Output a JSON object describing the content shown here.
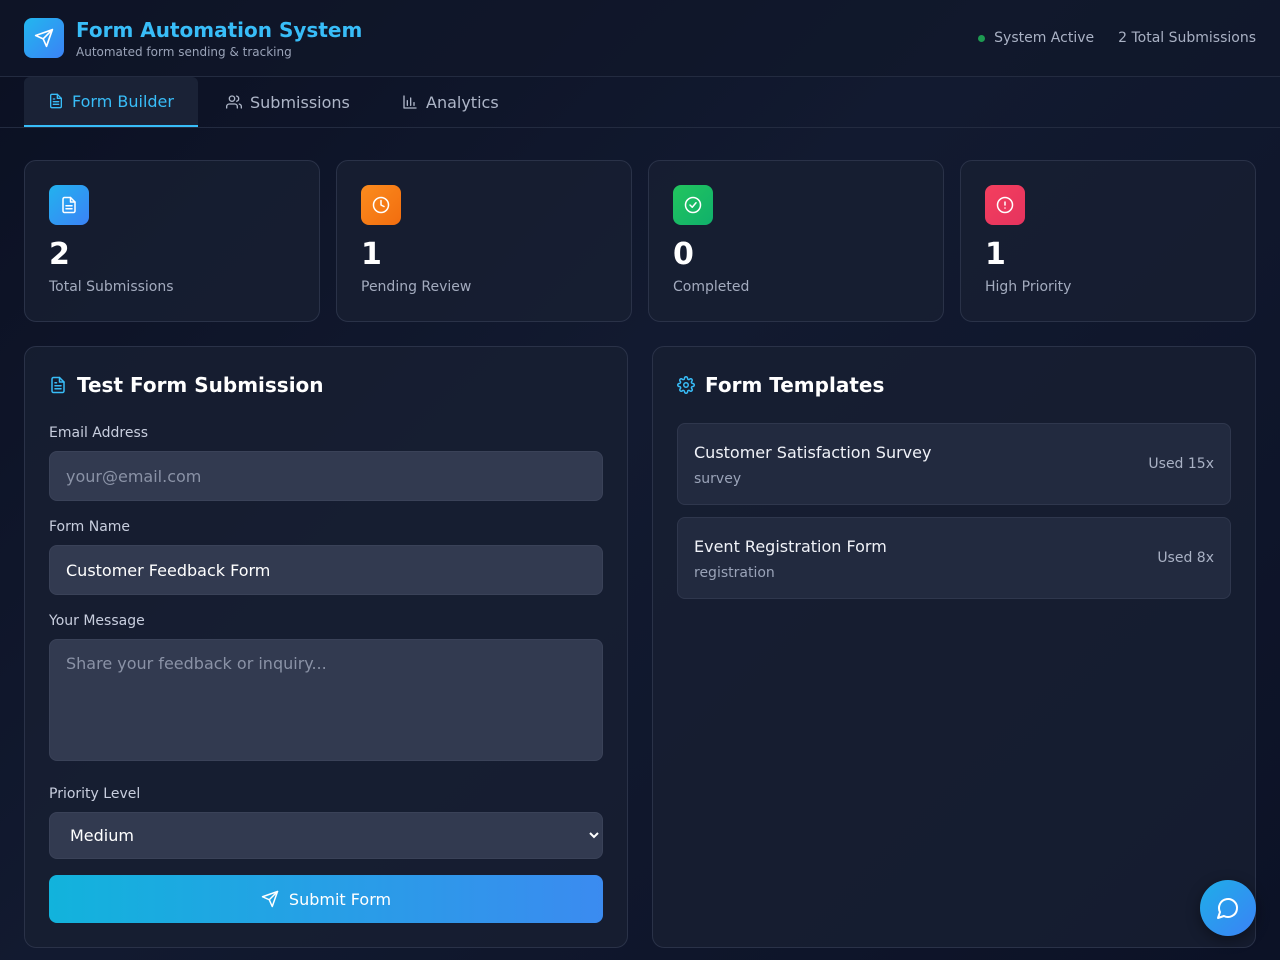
{
  "header": {
    "title": "Form Automation System",
    "subtitle": "Automated form sending & tracking",
    "status_text": "System Active",
    "submissions_text": "2 Total Submissions",
    "status_color": "#22c55e",
    "logo_icon": "send-icon"
  },
  "tabs": [
    {
      "label": "Form Builder",
      "icon": "file-text-icon",
      "active": true
    },
    {
      "label": "Submissions",
      "icon": "users-icon",
      "active": false
    },
    {
      "label": "Analytics",
      "icon": "bar-chart-icon",
      "active": false
    }
  ],
  "stats": [
    {
      "value": "2",
      "label": "Total Submissions",
      "icon": "file-text-icon",
      "color": "#2a9df4"
    },
    {
      "value": "1",
      "label": "Pending Review",
      "icon": "clock-icon",
      "color": "#f97316"
    },
    {
      "value": "0",
      "label": "Completed",
      "icon": "check-circle-icon",
      "color": "#22c55e"
    },
    {
      "value": "1",
      "label": "High Priority",
      "icon": "alert-circle-icon",
      "color": "#f43f5e"
    }
  ],
  "form": {
    "title": "Test Form Submission",
    "email_label": "Email Address",
    "email_value": "",
    "email_placeholder": "your@email.com",
    "form_name_label": "Form Name",
    "form_name_value": "Customer Feedback Form",
    "message_label": "Your Message",
    "message_value": "",
    "message_placeholder": "Share your feedback or inquiry...",
    "priority_label": "Priority Level",
    "priority_selected": "Medium",
    "submit_label": "Submit Form"
  },
  "templates": {
    "title": "Form Templates",
    "items": [
      {
        "name": "Customer Satisfaction Survey",
        "type": "survey",
        "used": "Used 15x"
      },
      {
        "name": "Event Registration Form",
        "type": "registration",
        "used": "Used 8x"
      }
    ]
  },
  "chat": {
    "icon": "message-circle-icon"
  }
}
